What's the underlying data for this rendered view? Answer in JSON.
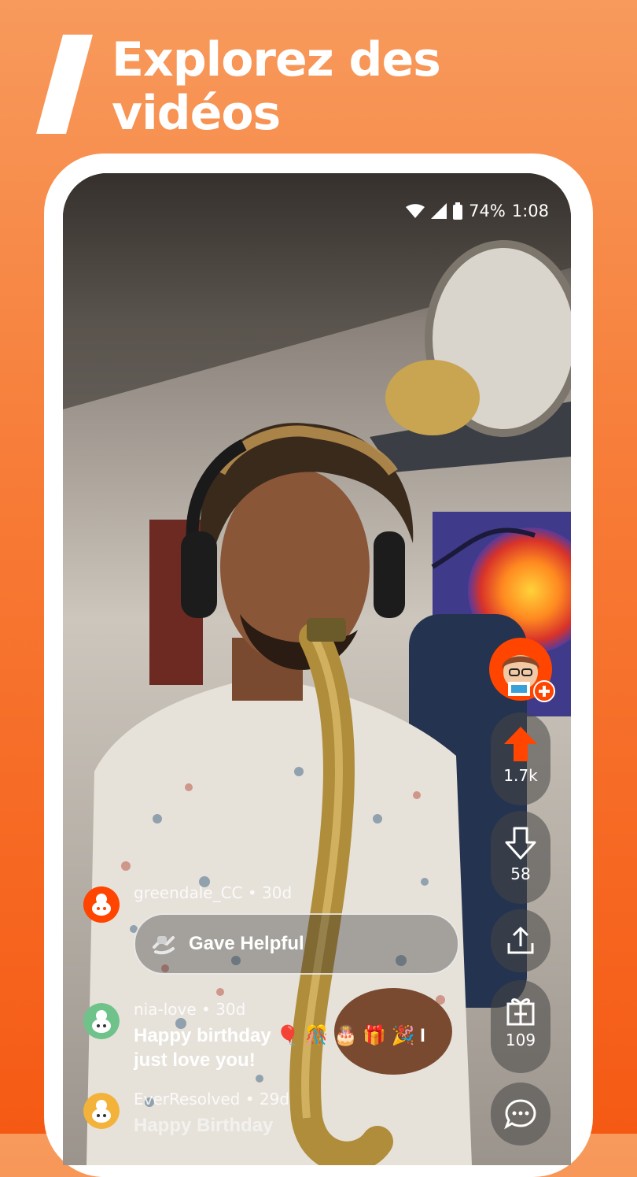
{
  "promo": {
    "headline_line1": "Explorez des",
    "headline_line2": "vidéos"
  },
  "status_bar": {
    "battery": "74%",
    "time": "1:08",
    "icons": [
      "wifi-icon",
      "signal-icon",
      "battery-icon"
    ]
  },
  "actions": {
    "follow_avatar": "creator-avatar-icon",
    "upvote": {
      "icon": "upvote-arrow-icon",
      "count": "1.7k",
      "color": "#ff4500"
    },
    "downvote": {
      "icon": "downvote-arrow-icon",
      "count": "58"
    },
    "share": {
      "icon": "share-icon"
    },
    "award": {
      "icon": "gift-icon",
      "count": "109"
    },
    "comment": {
      "icon": "comment-bubble-icon"
    }
  },
  "comments": [
    {
      "user": "greendale_CC",
      "age": "30d",
      "sep": "•",
      "award_label": "Gave Helpful"
    },
    {
      "user": "nia-love",
      "age": "30d",
      "sep": "•",
      "text": "Happy birthday 🎈 🎊 🎂 🎁 🎉 I just love you!"
    },
    {
      "user": "EverResolved",
      "age": "29d",
      "sep": "•",
      "text": "Happy Birthday"
    }
  ],
  "colors": {
    "brand_orange": "#ff4500",
    "background_top": "#f79a5c",
    "background_bottom": "#f55a14"
  }
}
